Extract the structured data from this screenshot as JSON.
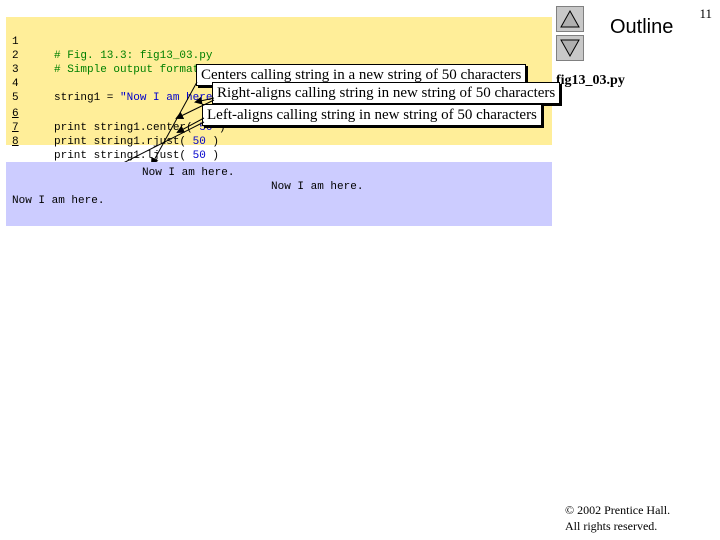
{
  "page": {
    "number": "11"
  },
  "nav": {
    "title": "Outline",
    "up_icon": "triangle-up-icon",
    "down_icon": "triangle-down-icon"
  },
  "slide": {
    "file_label": "fig13_03.py"
  },
  "code": {
    "lines": [
      {
        "num": "1",
        "text": "# Fig. 13.3: fig13_03.py"
      },
      {
        "num": "2",
        "text": "# Simple output formatting example."
      },
      {
        "num": "3",
        "text": ""
      },
      {
        "num": "4",
        "text_prefix": "string1 = ",
        "text_string": "\"Now I am here.\""
      },
      {
        "num": "5",
        "text": ""
      },
      {
        "num": "6",
        "text_prefix": "print string1.center( ",
        "text_number": "50",
        "text_suffix": " )"
      },
      {
        "num": "7",
        "text_prefix": "print string1.rjust( ",
        "text_number": "50",
        "text_suffix": " )"
      },
      {
        "num": "8",
        "text_prefix": "print string1.ljust( ",
        "text_number": "50",
        "text_suffix": " )"
      }
    ]
  },
  "callouts": {
    "center": "Centers calling string in a new string of 50 characters",
    "rjust": "Right-aligns calling string in new string of 50 characters",
    "ljust": "Left-aligns calling string in new string of 50 characters"
  },
  "output": {
    "lines": [
      "Now I am here.",
      "Now I am here.",
      "Now I am here."
    ]
  },
  "footer": {
    "copyright_line1": "© 2002 Prentice Hall.",
    "copyright_line2": "All rights reserved."
  }
}
